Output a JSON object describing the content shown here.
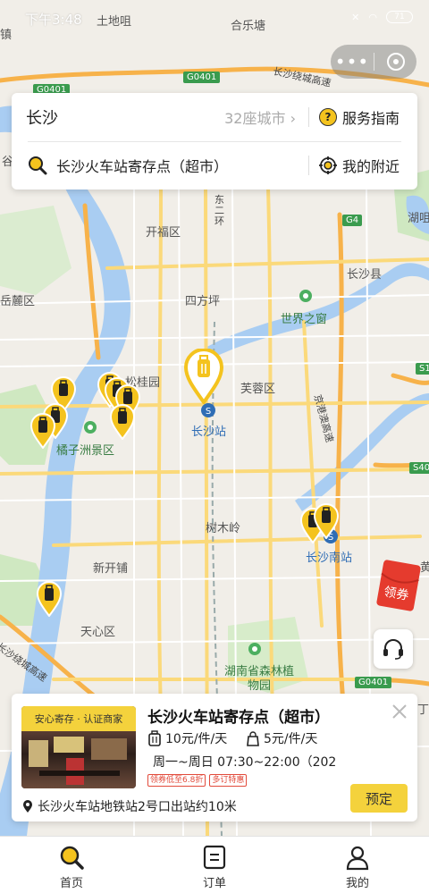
{
  "status_bar": {
    "time": "下午3:48",
    "battery": "71"
  },
  "top_card": {
    "city": "长沙",
    "city_count": "32座城市",
    "service_guide": "服务指南",
    "search_text": "长沙火车站寄存点（超市）",
    "nearby": "我的附近"
  },
  "map": {
    "labels": {
      "tudi": "土地咀",
      "hele": "合乐塘",
      "ring_top": "长沙绕城高速",
      "kaifu": "开福区",
      "dong2": "东二环",
      "hukou": "湖咀",
      "yuelu": "岳麓区",
      "changsha_county": "长沙县",
      "sifang": "四方坪",
      "shijie": "世界之窗",
      "songgui": "松桂园",
      "furong": "芙蓉区",
      "jinggang": "京港澳高速",
      "station": "长沙站",
      "juzi": "橘子洲景区",
      "shumu": "树木岭",
      "south_station": "长沙南站",
      "xinkai": "新开铺",
      "tianxin": "天心区",
      "ring_bottom": "长沙绕城高速",
      "forest": "湖南省森林植物园",
      "ding": "丁",
      "huang": "黄",
      "gu": "谷",
      "zhen": "镇"
    },
    "road_badges": {
      "g0401_left": "G0401",
      "g0401_top": "G0401",
      "g4": "G4",
      "s1": "S1",
      "s40": "S40",
      "g0401_bottom": "G0401"
    },
    "coupon_label": "领券"
  },
  "store": {
    "badge": "安心寄存 · 认证商家",
    "name": "长沙火车站寄存点（超市）",
    "price_large": "10元/件/天",
    "price_small": "5元/件/天",
    "hours": "周一~周日 07:30~22:00（202...",
    "tags": [
      "领券低至6.8折",
      "多订特惠"
    ],
    "address": "长沙火车站地铁站2号口出站约10米",
    "book": "预定"
  },
  "tabs": [
    {
      "label": "首页",
      "icon": "search-icon"
    },
    {
      "label": "订单",
      "icon": "order-icon"
    },
    {
      "label": "我的",
      "icon": "user-icon"
    }
  ],
  "colors": {
    "accent": "#f4d23c",
    "pin": "#f4c31e",
    "river": "#a9cdf2",
    "green": "#3a7d44"
  }
}
